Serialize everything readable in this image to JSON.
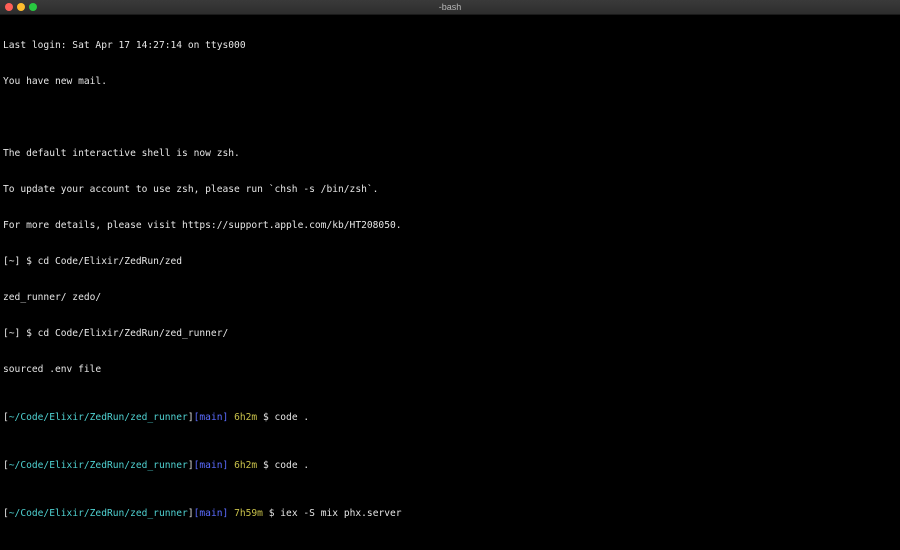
{
  "window": {
    "title": "-bash",
    "traffic_colors": {
      "close": "#ff5f57",
      "minimize": "#febc2e",
      "zoom": "#28c840"
    }
  },
  "terminal": {
    "lines": [
      "Last login: Sat Apr 17 14:27:14 on ttys000",
      "You have new mail.",
      "",
      "The default interactive shell is now zsh.",
      "To update your account to use zsh, please run `chsh -s /bin/zsh`.",
      "For more details, please visit https://support.apple.com/kb/HT208050.",
      "[~] $ cd Code/Elixir/ZedRun/zed",
      "zed_runner/ zedo/",
      "[~] $ cd Code/Elixir/ZedRun/zed_runner/",
      "sourced .env file"
    ],
    "prompts": [
      {
        "open": "[",
        "path": "~/Code/Elixir/ZedRun/zed_runner",
        "close": "]",
        "branch": "[main]",
        "time": "6h2m",
        "command": "$ code ."
      },
      {
        "open": "[",
        "path": "~/Code/Elixir/ZedRun/zed_runner",
        "close": "]",
        "branch": "[main]",
        "time": "6h2m",
        "command": "$ code ."
      },
      {
        "open": "[",
        "path": "~/Code/Elixir/ZedRun/zed_runner",
        "close": "]",
        "branch": "[main]",
        "time": "7h59m",
        "command": "$ iex -S mix phx.server"
      }
    ],
    "colors": {
      "background": "#000000",
      "text": "#e6e6e6",
      "path": "#4fd1d1",
      "branch": "#5b6cff",
      "time": "#c9c24a"
    }
  }
}
